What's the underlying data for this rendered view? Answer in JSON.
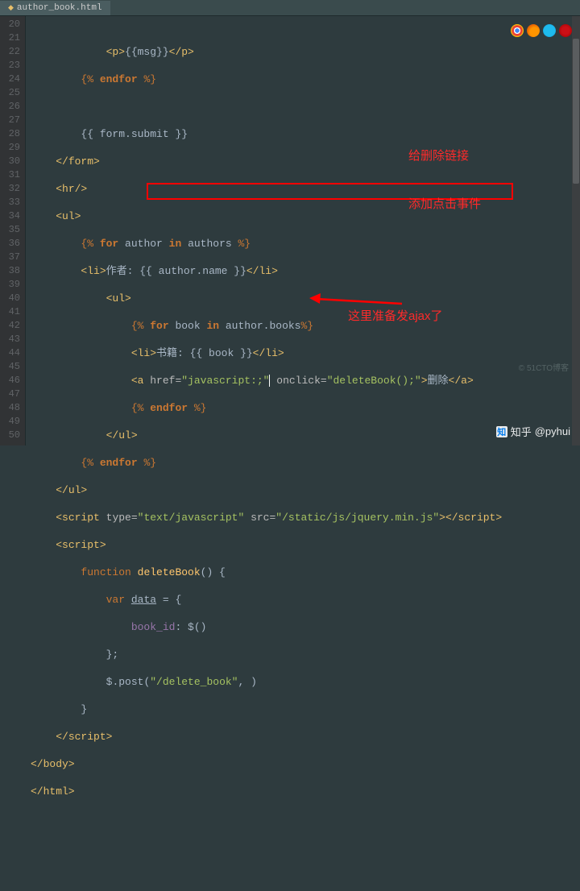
{
  "tab": {
    "filename": "author_book.html"
  },
  "gutter": {
    "start": 20,
    "end": 50
  },
  "code": {
    "l20": {
      "open": "<p>",
      "tpl": "{{msg}}",
      "close": "</p>"
    },
    "l21": {
      "tpl": "{% ",
      "kw": "endfor",
      "tpl2": " %}"
    },
    "l22": "",
    "l23": {
      "tpl": "{{ form.submit }}"
    },
    "l24": {
      "close": "</form>"
    },
    "l25": {
      "tag": "<hr/>"
    },
    "l26": {
      "tag": "<ul>"
    },
    "l27": {
      "tpl": "{% ",
      "kw": "for",
      "expr": " author ",
      "kw2": "in",
      "expr2": " authors ",
      "tpl2": "%}"
    },
    "l28": {
      "open": "<li>",
      "txt": "作者: ",
      "tpl": "{{ author.name }}",
      "close": "</li>"
    },
    "l29": {
      "tag": "<ul>"
    },
    "l30": {
      "tpl": "{% ",
      "kw": "for",
      "expr": " book ",
      "kw2": "in",
      "expr2": " author.books",
      "tpl2": "%}"
    },
    "l31": {
      "open": "<li>",
      "txt": "书籍: ",
      "tpl": "{{ book }}",
      "close": "</li>"
    },
    "l32": {
      "open": "<a ",
      "attr1": "href=",
      "val1": "\"javascript:;\"",
      "attr2": " onclick=",
      "val2": "\"deleteBook();\"",
      "mid": ">",
      "txt": "删除",
      "close": "</a>"
    },
    "l33": {
      "tpl": "{% ",
      "kw": "endfor",
      "tpl2": " %}"
    },
    "l34": {
      "close": "</ul>"
    },
    "l35": {
      "tpl": "{% ",
      "kw": "endfor",
      "tpl2": " %}"
    },
    "l36": {
      "close": "</ul>"
    },
    "l37": {
      "open": "<script ",
      "attr1": "type=",
      "val1": "\"text/javascript\"",
      "attr2": " src=",
      "val2": "\"/static/js/jquery.min.js\"",
      "mid": ">",
      "close": "</script>"
    },
    "l38": {
      "open": "<script>"
    },
    "l39": {
      "kw": "function ",
      "fn": "deleteBook",
      "paren": "() {"
    },
    "l40": {
      "kw": "var ",
      "var": "data",
      "rest": " = {"
    },
    "l41": {
      "prop": "book_id",
      "rest": ": ",
      "jq": "$()"
    },
    "l42": {
      "rest": "};"
    },
    "l43": {
      "jq": "$",
      "rest": ".post(",
      "str": "\"/delete_book\"",
      "rest2": ", )"
    },
    "l44": {
      "rest": "}"
    },
    "l45": {
      "close": "</script>"
    },
    "l46": {
      "close": "</body>"
    },
    "l47": {
      "close": "</html>"
    }
  },
  "annotations": {
    "a1_line1": "给删除链接",
    "a1_line2": "添加点击事件",
    "a2": "这里准备发ajax了"
  },
  "watermark": {
    "site": "知乎",
    "handle": "@pyhui"
  },
  "watermark2": "© 51CTO博客"
}
